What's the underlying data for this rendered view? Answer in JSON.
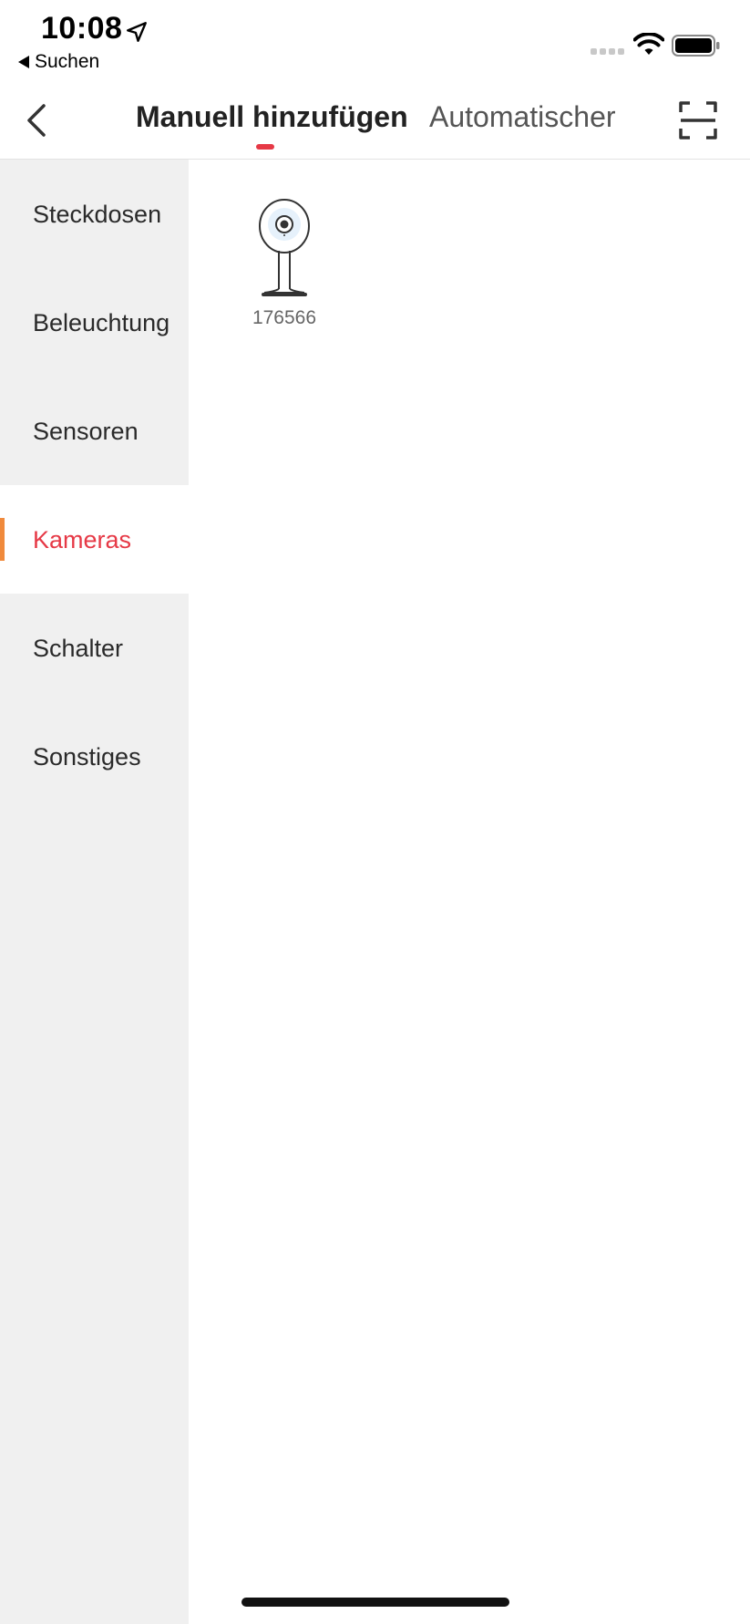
{
  "status_bar": {
    "time": "10:08",
    "back_app_label": "Suchen"
  },
  "nav": {
    "tabs": [
      {
        "label": "Manuell hinzufügen",
        "active": true
      },
      {
        "label": "Automatischer",
        "active": false
      }
    ]
  },
  "sidebar": {
    "items": [
      {
        "label": "Steckdosen",
        "active": false
      },
      {
        "label": "Beleuchtung",
        "active": false
      },
      {
        "label": "Sensoren",
        "active": false
      },
      {
        "label": "Kameras",
        "active": true
      },
      {
        "label": "Schalter",
        "active": false
      },
      {
        "label": "Sonstiges",
        "active": false
      }
    ]
  },
  "content": {
    "devices": [
      {
        "label": "176566",
        "icon": "indoor-camera"
      }
    ]
  },
  "colors": {
    "accent": "#e63946",
    "active_marker": "#f08a3c",
    "sidebar_bg": "#f0f0f0"
  }
}
